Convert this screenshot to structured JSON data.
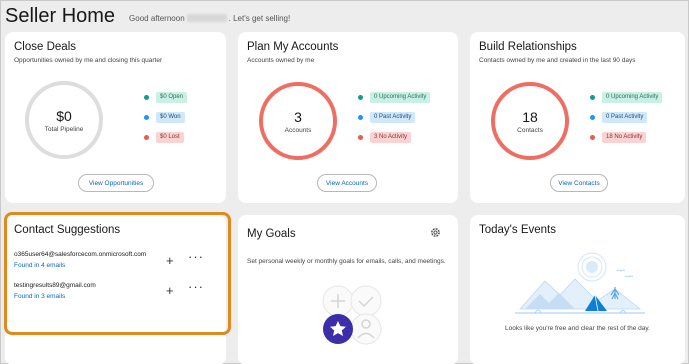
{
  "header": {
    "title": "Seller Home",
    "greeting_prefix": "Good afternoon",
    "greeting_suffix": ". Let's get selling!"
  },
  "close_deals": {
    "title": "Close Deals",
    "subtitle": "Opportunities owned by me and closing this quarter",
    "ring_value": "$0",
    "ring_label": "Total Pipeline",
    "legend": [
      "$0 Open",
      "$0 Won",
      "$0 Lost"
    ],
    "button": "View Opportunities"
  },
  "plan_accounts": {
    "title": "Plan My Accounts",
    "subtitle": "Accounts owned by me",
    "ring_value": "3",
    "ring_label": "Accounts",
    "legend": [
      "0 Upcoming Activity",
      "0 Past Activity",
      "3 No Activity"
    ],
    "button": "View Accounts"
  },
  "build_relationships": {
    "title": "Build Relationships",
    "subtitle": "Contacts owned by me and created in the last 90 days",
    "ring_value": "18",
    "ring_label": "Contacts",
    "legend": [
      "0 Upcoming Activity",
      "0 Past Activity",
      "18 No Activity"
    ],
    "button": "View Contacts"
  },
  "contact_suggestions": {
    "title": "Contact Suggestions",
    "items": [
      {
        "email": "o365user64@salesforcecom.onmicrosoft.com",
        "found": "Found in 4 emails"
      },
      {
        "email": "testingresults89@gmail.com",
        "found": "Found in 3 emails"
      }
    ],
    "add_icon": "plus-icon",
    "more_icon": "more-icon"
  },
  "my_goals": {
    "title": "My Goals",
    "description": "Set personal weekly or monthly goals for emails, calls, and meetings.",
    "settings_icon": "gear-icon"
  },
  "todays_events": {
    "title": "Today's Events",
    "message": "Looks like you're free and clear the rest of the day."
  },
  "colors": {
    "ring_grey": "#dddddd",
    "ring_red": "#ef6e64",
    "teal": "#0f9d8f",
    "blue": "#1b96ff",
    "red": "#ea5a4e",
    "link": "#0b66c2",
    "highlight": "#e08a1e"
  }
}
